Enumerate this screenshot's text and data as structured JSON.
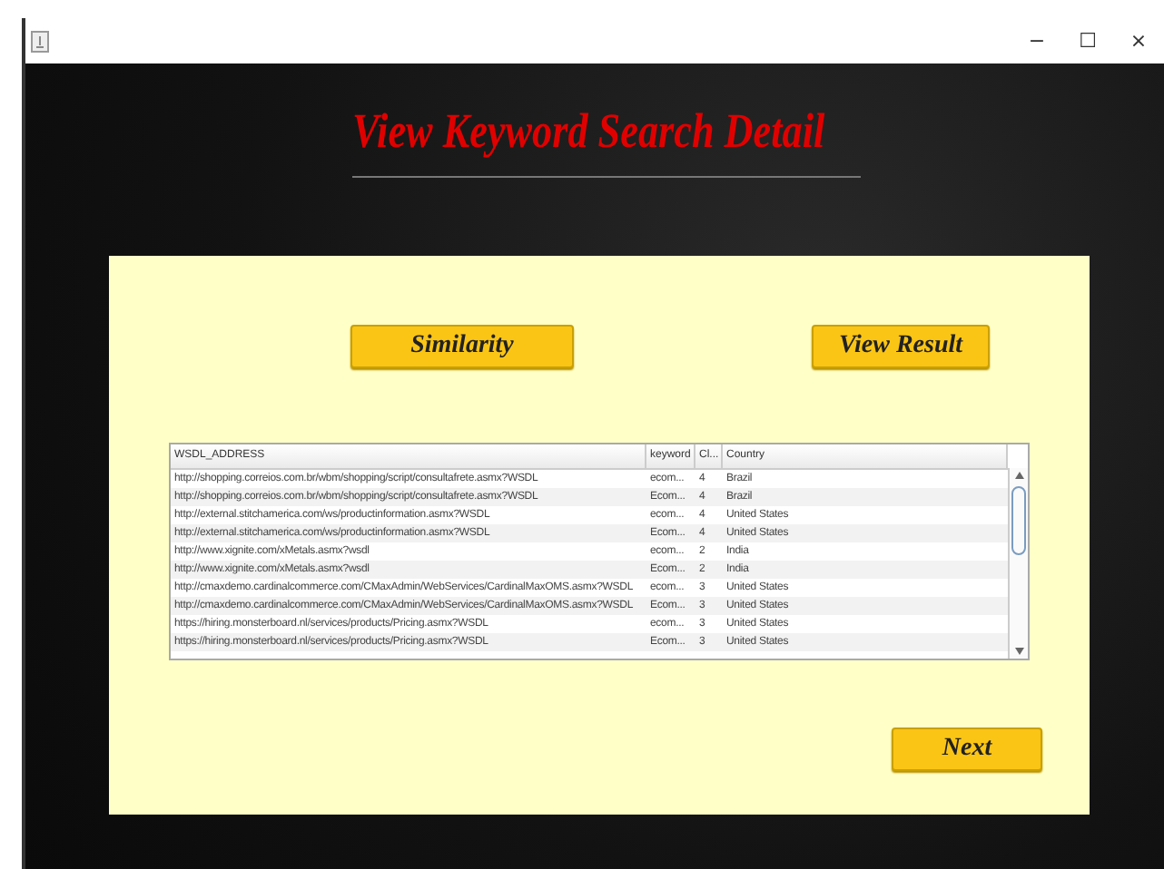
{
  "window": {
    "title_bar_buttons": [
      "−",
      "☐",
      "×"
    ]
  },
  "heading": "View Keyword Search Detail",
  "buttons": [
    {
      "label": "Similarity",
      "kind": "top-left"
    },
    {
      "label": "View Result",
      "kind": "top-right"
    },
    {
      "label": "Next",
      "kind": "bottom-right"
    }
  ],
  "table": {
    "columns": [
      "WSDL_ADDRESS",
      "keyword",
      "Cl...",
      "Country"
    ],
    "rows": [
      [
        "http://shopping.correios.com.br/wbm/shopping/script/consultafrete.asmx?WSDL",
        "ecom...",
        "4",
        "Brazil"
      ],
      [
        "http://shopping.correios.com.br/wbm/shopping/script/consultafrete.asmx?WSDL",
        "Ecom...",
        "4",
        "Brazil"
      ],
      [
        "http://external.stitchamerica.com/ws/productinformation.asmx?WSDL",
        "ecom...",
        "4",
        "United States"
      ],
      [
        "http://external.stitchamerica.com/ws/productinformation.asmx?WSDL",
        "Ecom...",
        "4",
        "United States"
      ],
      [
        "http://www.xignite.com/xMetals.asmx?wsdl",
        "ecom...",
        "2",
        "India"
      ],
      [
        "http://www.xignite.com/xMetals.asmx?wsdl",
        "Ecom...",
        "2",
        "India"
      ],
      [
        "http://cmaxdemo.cardinalcommerce.com/CMaxAdmin/WebServices/CardinalMaxOMS.asmx?WSDL",
        "ecom...",
        "3",
        "United States"
      ],
      [
        "http://cmaxdemo.cardinalcommerce.com/CMaxAdmin/WebServices/CardinalMaxOMS.asmx?WSDL",
        "Ecom...",
        "3",
        "United States"
      ],
      [
        "https://hiring.monsterboard.nl/services/products/Pricing.asmx?WSDL",
        "ecom...",
        "3",
        "United States"
      ],
      [
        "https://hiring.monsterboard.nl/services/products/Pricing.asmx?WSDL",
        "Ecom...",
        "3",
        "United States"
      ]
    ]
  }
}
